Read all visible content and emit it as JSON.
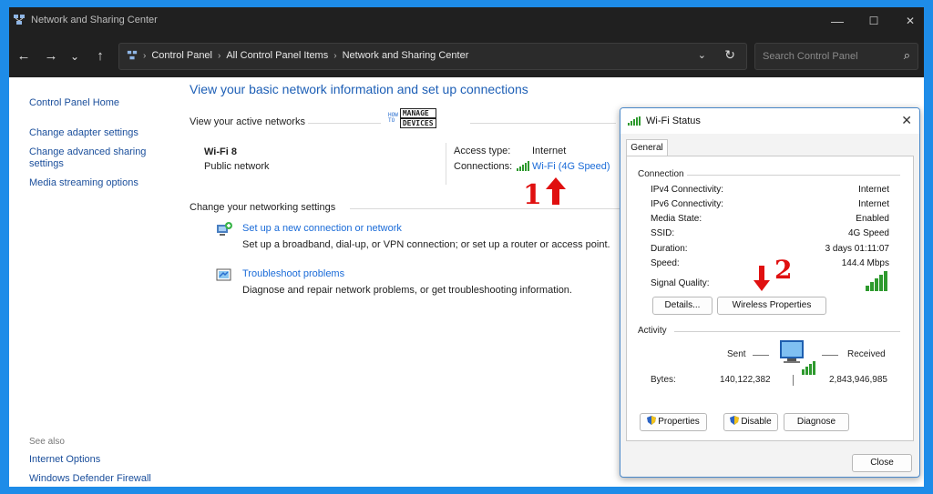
{
  "window": {
    "title": "Network and Sharing Center",
    "controls": {
      "minimize": "—",
      "maximize": "☐",
      "close": "✕"
    }
  },
  "nav": {
    "back": "←",
    "forward": "→",
    "recent": "⌄",
    "up": "↑",
    "breadcrumbs": [
      "Control Panel",
      "All Control Panel Items",
      "Network and Sharing Center"
    ],
    "search_placeholder": "Search Control Panel"
  },
  "sidebar": {
    "items": [
      "Control Panel Home",
      "Change adapter settings",
      "Change advanced sharing settings",
      "Media streaming options"
    ],
    "see_also_label": "See also",
    "see_also": [
      "Internet Options",
      "Windows Defender Firewall"
    ]
  },
  "main": {
    "heading": "View your basic network information and set up connections",
    "active_networks_label": "View your active networks",
    "network_name": "Wi-Fi 8",
    "network_type": "Public network",
    "access_type_label": "Access type:",
    "access_type_value": "Internet",
    "connections_label": "Connections:",
    "connections_value": "Wi-Fi (4G Speed)",
    "change_settings_label": "Change your networking settings",
    "setup_link": "Set up a new connection or network",
    "setup_desc": "Set up a broadband, dial-up, or VPN connection; or set up a router or access point.",
    "troubleshoot_link": "Troubleshoot problems",
    "troubleshoot_desc": "Diagnose and repair network problems, or get troubleshooting information."
  },
  "logo": {
    "how": "HOW",
    "to": "TO",
    "manage": "MANAGE",
    "devices": "DEVICES"
  },
  "annotations": {
    "one": "1",
    "two": "2"
  },
  "dialog": {
    "title": "Wi-Fi Status",
    "tab": "General",
    "connection_label": "Connection",
    "rows": [
      {
        "k": "IPv4 Connectivity:",
        "v": "Internet"
      },
      {
        "k": "IPv6 Connectivity:",
        "v": "Internet"
      },
      {
        "k": "Media State:",
        "v": "Enabled"
      },
      {
        "k": "SSID:",
        "v": "4G Speed"
      },
      {
        "k": "Duration:",
        "v": "3 days 01:11:07"
      },
      {
        "k": "Speed:",
        "v": "144.4 Mbps"
      }
    ],
    "signal_quality_label": "Signal Quality:",
    "details_button": "Details...",
    "wireless_props_button": "Wireless Properties",
    "activity_label": "Activity",
    "sent_label": "Sent",
    "received_label": "Received",
    "bytes_label": "Bytes:",
    "bytes_sent": "140,122,382",
    "bytes_received": "2,843,946,985",
    "properties_button": "Properties",
    "disable_button": "Disable",
    "diagnose_button": "Diagnose",
    "close_button": "Close"
  },
  "colors": {
    "accent": "#1e8ce8",
    "link": "#1a6bd8",
    "signal": "#2e9a2e",
    "annotation": "#e01010"
  }
}
